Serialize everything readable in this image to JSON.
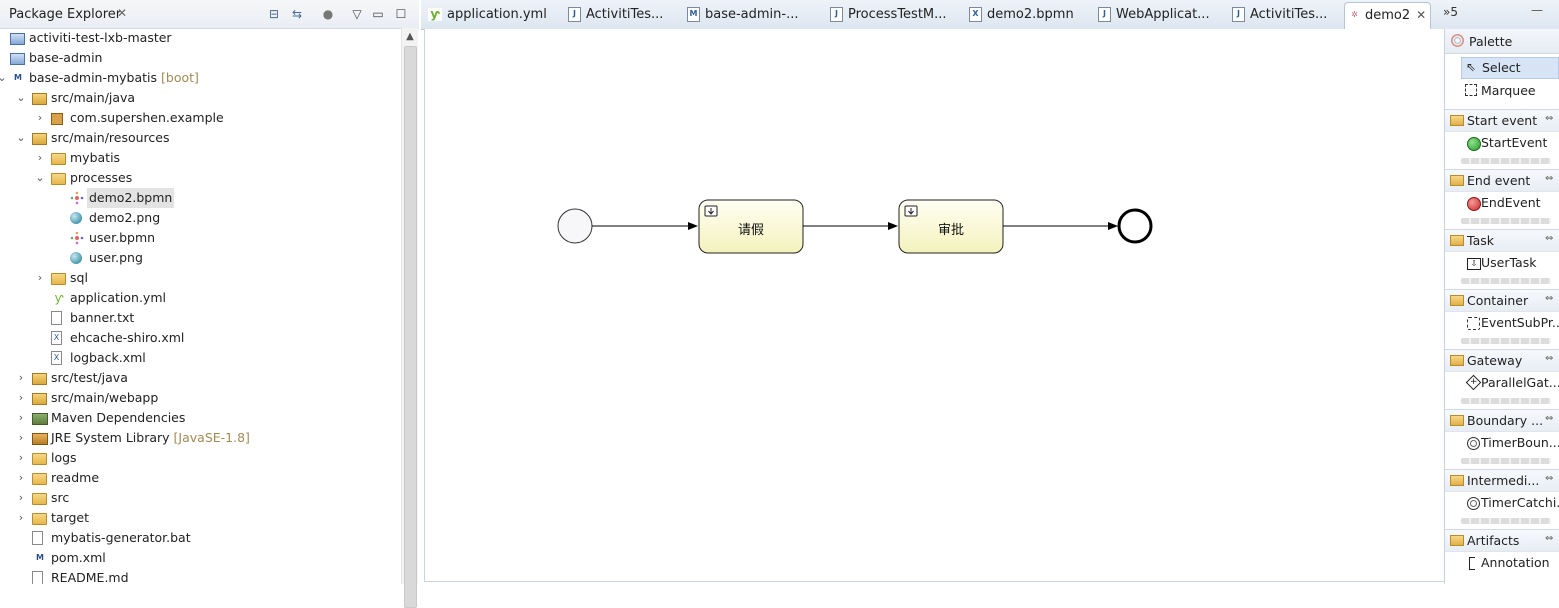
{
  "explorer": {
    "title": "Package Explorer",
    "close": "✕",
    "tree": [
      {
        "label": "activiti-test-lxb-master",
        "depth": 0,
        "twisty": "",
        "icon": "project"
      },
      {
        "label": "base-admin",
        "depth": 0,
        "twisty": "",
        "icon": "project"
      },
      {
        "label": "base-admin-mybatis",
        "decoration": "[boot]",
        "depth": 0,
        "twisty": "⌄",
        "icon": "maven"
      },
      {
        "label": "src/main/java",
        "depth": 1,
        "twisty": "⌄",
        "icon": "pkgfolder"
      },
      {
        "label": "com.supershen.example",
        "depth": 2,
        "twisty": "›",
        "icon": "pkg"
      },
      {
        "label": "src/main/resources",
        "depth": 1,
        "twisty": "⌄",
        "icon": "pkgfolder"
      },
      {
        "label": "mybatis",
        "depth": 2,
        "twisty": "›",
        "icon": "folder"
      },
      {
        "label": "processes",
        "depth": 2,
        "twisty": "⌄",
        "icon": "folder"
      },
      {
        "label": "demo2.bpmn",
        "depth": 3,
        "twisty": "",
        "icon": "bpmn",
        "selected": true
      },
      {
        "label": "demo2.png",
        "depth": 3,
        "twisty": "",
        "icon": "globe"
      },
      {
        "label": "user.bpmn",
        "depth": 3,
        "twisty": "",
        "icon": "bpmn"
      },
      {
        "label": "user.png",
        "depth": 3,
        "twisty": "",
        "icon": "globe"
      },
      {
        "label": "sql",
        "depth": 2,
        "twisty": "›",
        "icon": "folder"
      },
      {
        "label": "application.yml",
        "depth": 2,
        "twisty": "",
        "icon": "yml"
      },
      {
        "label": "banner.txt",
        "depth": 2,
        "twisty": "",
        "icon": "file"
      },
      {
        "label": "ehcache-shiro.xml",
        "depth": 2,
        "twisty": "",
        "icon": "xml"
      },
      {
        "label": "logback.xml",
        "depth": 2,
        "twisty": "",
        "icon": "xml"
      },
      {
        "label": "src/test/java",
        "depth": 1,
        "twisty": "›",
        "icon": "pkgfolder"
      },
      {
        "label": "src/main/webapp",
        "depth": 1,
        "twisty": "›",
        "icon": "pkgfolder"
      },
      {
        "label": "Maven Dependencies",
        "depth": 1,
        "twisty": "›",
        "icon": "lib"
      },
      {
        "label": "JRE System Library",
        "decoration": "[JavaSE-1.8]",
        "depth": 1,
        "twisty": "›",
        "icon": "jre"
      },
      {
        "label": "logs",
        "depth": 1,
        "twisty": "›",
        "icon": "folder"
      },
      {
        "label": "readme",
        "depth": 1,
        "twisty": "›",
        "icon": "folder"
      },
      {
        "label": "src",
        "depth": 1,
        "twisty": "›",
        "icon": "folder"
      },
      {
        "label": "target",
        "depth": 1,
        "twisty": "›",
        "icon": "folder"
      },
      {
        "label": "mybatis-generator.bat",
        "depth": 1,
        "twisty": "",
        "icon": "file"
      },
      {
        "label": "pom.xml",
        "depth": 1,
        "twisty": "",
        "icon": "maven"
      },
      {
        "label": "README.md",
        "depth": 1,
        "twisty": "",
        "icon": "file"
      }
    ]
  },
  "editor": {
    "tabs": [
      {
        "label": "application.yml",
        "icon": "yml",
        "active": false
      },
      {
        "label": "ActivitiTes...",
        "icon": "J",
        "active": false
      },
      {
        "label": "base-admin-...",
        "icon": "M",
        "active": false
      },
      {
        "label": "ProcessTestM...",
        "icon": "J",
        "active": false
      },
      {
        "label": "demo2.bpmn",
        "icon": "X",
        "active": false
      },
      {
        "label": "WebApplicat...",
        "icon": "J",
        "active": false
      },
      {
        "label": "ActivitiTes...",
        "icon": "J",
        "active": false
      },
      {
        "label": "demo2",
        "icon": "bpmn",
        "active": true
      }
    ],
    "close": "✕",
    "overflow": "»5",
    "minimize": "—"
  },
  "diagram": {
    "tasks": [
      {
        "label": "请假",
        "icon": "user-task-icon"
      },
      {
        "label": "审批",
        "icon": "user-task-icon"
      }
    ]
  },
  "palette": {
    "title": "Palette",
    "tools": [
      {
        "label": "Select",
        "selected": true
      },
      {
        "label": "Marquee",
        "selected": false
      }
    ],
    "drawers": [
      {
        "label": "Start event",
        "item": "StartEvent"
      },
      {
        "label": "End event",
        "item": "EndEvent"
      },
      {
        "label": "Task",
        "item": "UserTask"
      },
      {
        "label": "Container",
        "item": "EventSubPr..."
      },
      {
        "label": "Gateway",
        "item": "ParallelGat..."
      },
      {
        "label": "Boundary ...",
        "item": "TimerBoun..."
      },
      {
        "label": "Intermedi...",
        "item": "TimerCatchi..."
      },
      {
        "label": "Artifacts",
        "item": "Annotation"
      }
    ]
  },
  "colors": {
    "task_fill_top": "#fffff0",
    "task_fill_bottom": "#f6f4c2",
    "start_event": "#3fa33f",
    "end_event": "#d33b3b"
  }
}
